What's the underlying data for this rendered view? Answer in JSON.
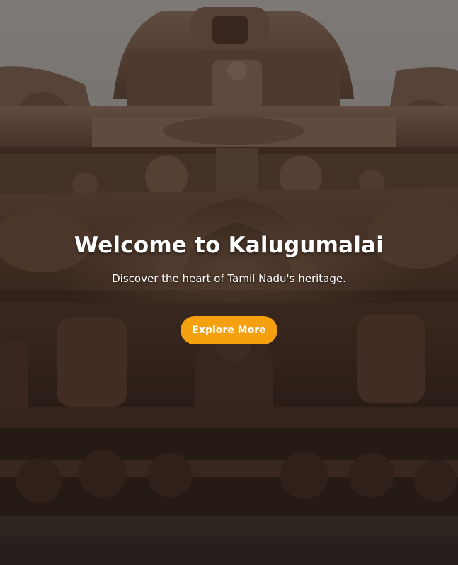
{
  "hero": {
    "title": "Welcome to Kalugumalai",
    "subtitle": "Discover the heart of Tamil Nadu's heritage.",
    "cta_label": "Explore More",
    "background_image": "temple-carving-photo"
  },
  "colors": {
    "accent": "#f5a00f",
    "text": "#ffffff",
    "overlay": "rgba(0,0,0,0.38)",
    "stone": "#7a5a48"
  }
}
